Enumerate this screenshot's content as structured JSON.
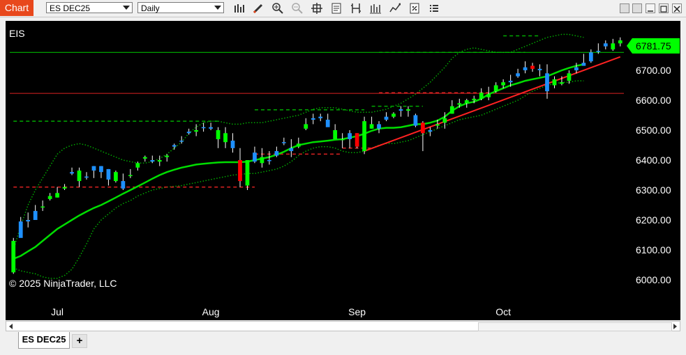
{
  "window": {
    "chart_label": "Chart",
    "instrument": "ES DEC25",
    "period": "Daily",
    "tab_label": "ES DEC25",
    "add_tab": "+",
    "toolbar_icons": [
      "bar-type-icon",
      "draw-tool-icon",
      "zoom-in-icon",
      "zoom-out-icon",
      "crosshair-icon",
      "data-box-icon",
      "indicators-icon",
      "strategies-icon",
      "chart-trader-icon",
      "properties-icon",
      "options-icon"
    ]
  },
  "chart_data": {
    "type": "candlestick",
    "instrument_label": "EIS",
    "copyright": "© 2025 NinjaTrader, LLC",
    "last_price": "6781.75",
    "y_tick_labels": [
      "6700.00",
      "6600.00",
      "6500.00",
      "6400.00",
      "6300.00",
      "6200.00",
      "6100.00",
      "6000.00"
    ],
    "y_ticks": [
      6700,
      6600,
      6500,
      6400,
      6300,
      6200,
      6100,
      6000
    ],
    "x_tick_labels": [
      "Jul",
      "Aug",
      "Sep",
      "Oct"
    ],
    "x_tick_bar_index": [
      6,
      27,
      47,
      67
    ],
    "colors": {
      "up": "#00ff00",
      "down": "#ff0000",
      "neutral": "#1e90ff",
      "ma": "#00dd00",
      "band": "#00aa00",
      "level_green": "#00cc00",
      "level_red": "#dd2222",
      "price_tag": "#00ff00"
    },
    "candles": [
      [
        6130,
        6140,
        6020,
        6025
      ],
      [
        6195,
        6210,
        6180,
        6140
      ],
      [
        6200,
        6225,
        6175,
        6195
      ],
      [
        6230,
        6250,
        6220,
        6200
      ],
      [
        6245,
        6265,
        6230,
        6245
      ],
      [
        6270,
        6290,
        6265,
        6280
      ],
      [
        6290,
        6310,
        6275,
        6275
      ],
      [
        6305,
        6320,
        6300,
        6310
      ],
      [
        6355,
        6375,
        6350,
        6360
      ],
      [
        6330,
        6375,
        6310,
        6365
      ],
      [
        6345,
        6360,
        6335,
        6345
      ],
      [
        6365,
        6380,
        6340,
        6380
      ],
      [
        6360,
        6380,
        6340,
        6380
      ],
      [
        6335,
        6370,
        6315,
        6370
      ],
      [
        6330,
        6365,
        6325,
        6360
      ],
      [
        6305,
        6355,
        6300,
        6330
      ],
      [
        6350,
        6370,
        6340,
        6350
      ],
      [
        6375,
        6395,
        6365,
        6390
      ],
      [
        6405,
        6415,
        6395,
        6410
      ],
      [
        6400,
        6415,
        6390,
        6395
      ],
      [
        6400,
        6415,
        6380,
        6395
      ],
      [
        6410,
        6420,
        6395,
        6415
      ],
      [
        6445,
        6455,
        6435,
        6450
      ],
      [
        6465,
        6480,
        6455,
        6465
      ],
      [
        6495,
        6505,
        6485,
        6490
      ],
      [
        6500,
        6520,
        6480,
        6495
      ],
      [
        6510,
        6525,
        6495,
        6510
      ],
      [
        6510,
        6525,
        6500,
        6505
      ],
      [
        6500,
        6510,
        6440,
        6470
      ],
      [
        6490,
        6510,
        6440,
        6460
      ],
      [
        6465,
        6490,
        6425,
        6440
      ],
      [
        6400,
        6440,
        6310,
        6330
      ],
      [
        6315,
        6400,
        6300,
        6400
      ],
      [
        6425,
        6445,
        6390,
        6395
      ],
      [
        6410,
        6440,
        6375,
        6390
      ],
      [
        6400,
        6430,
        6385,
        6400
      ],
      [
        6430,
        6445,
        6410,
        6415
      ],
      [
        6460,
        6475,
        6450,
        6460
      ],
      [
        6440,
        6470,
        6410,
        6430
      ],
      [
        6455,
        6475,
        6440,
        6445
      ],
      [
        6520,
        6540,
        6500,
        6505
      ],
      [
        6540,
        6555,
        6520,
        6535
      ],
      [
        6545,
        6555,
        6530,
        6540
      ],
      [
        6535,
        6555,
        6515,
        6510
      ],
      [
        6500,
        6520,
        6475,
        6470
      ],
      [
        6470,
        6490,
        6440,
        6470
      ],
      [
        6470,
        6500,
        6440,
        6490
      ],
      [
        6445,
        6490,
        6440,
        6490
      ],
      [
        6530,
        6545,
        6420,
        6430
      ],
      [
        6520,
        6545,
        6505,
        6505
      ],
      [
        6505,
        6530,
        6490,
        6520
      ],
      [
        6545,
        6560,
        6530,
        6535
      ],
      [
        6545,
        6560,
        6540,
        6555
      ],
      [
        6570,
        6580,
        6545,
        6565
      ],
      [
        6570,
        6580,
        6545,
        6565
      ],
      [
        6515,
        6555,
        6510,
        6550
      ],
      [
        6490,
        6530,
        6430,
        6525
      ],
      [
        6500,
        6510,
        6480,
        6495
      ],
      [
        6520,
        6535,
        6505,
        6515
      ],
      [
        6525,
        6560,
        6505,
        6540
      ],
      [
        6580,
        6600,
        6555,
        6555
      ],
      [
        6585,
        6605,
        6575,
        6590
      ],
      [
        6590,
        6605,
        6575,
        6600
      ],
      [
        6600,
        6615,
        6590,
        6605
      ],
      [
        6625,
        6640,
        6600,
        6605
      ],
      [
        6620,
        6645,
        6600,
        6610
      ],
      [
        6650,
        6660,
        6625,
        6630
      ],
      [
        6660,
        6670,
        6640,
        6650
      ],
      [
        6665,
        6685,
        6645,
        6660
      ],
      [
        6690,
        6705,
        6675,
        6680
      ],
      [
        6700,
        6730,
        6690,
        6710
      ],
      [
        6715,
        6725,
        6695,
        6705
      ],
      [
        6705,
        6720,
        6680,
        6700
      ],
      [
        6690,
        6720,
        6605,
        6630
      ],
      [
        6670,
        6680,
        6640,
        6650
      ],
      [
        6660,
        6680,
        6650,
        6655
      ],
      [
        6690,
        6700,
        6655,
        6665
      ],
      [
        6710,
        6725,
        6690,
        6700
      ],
      [
        6725,
        6755,
        6715,
        6715
      ],
      [
        6760,
        6770,
        6725,
        6730
      ],
      [
        6765,
        6790,
        6755,
        6765
      ],
      [
        6790,
        6800,
        6770,
        6780
      ],
      [
        6790,
        6805,
        6765,
        6770
      ],
      [
        6800,
        6810,
        6780,
        6790
      ]
    ],
    "bar_colors": "gbbbggggbgbbbbgbgggbggbbbgbbggbrgbgbbbbggbbbggbrggbbgbgbrbggggggggggbbbrbbgggbbbbb",
    "moving_average": {
      "from_index": 0,
      "values": [
        6070,
        6080,
        6095,
        6110,
        6130,
        6150,
        6170,
        6185,
        6200,
        6215,
        6228,
        6240,
        6250,
        6262,
        6275,
        6288,
        6300,
        6312,
        6325,
        6338,
        6350,
        6360,
        6368,
        6375,
        6380,
        6385,
        6388,
        6390,
        6392,
        6393,
        6393,
        6393,
        6395,
        6400,
        6405,
        6410,
        6418,
        6428,
        6440,
        6450,
        6455,
        6460,
        6462,
        6465,
        6468,
        6470,
        6475,
        6480,
        6488,
        6498,
        6505,
        6508,
        6508,
        6510,
        6515,
        6520,
        6520,
        6525,
        6532,
        6545,
        6565,
        6580,
        6590,
        6595,
        6605,
        6620,
        6630,
        6640,
        6650,
        6657,
        6665,
        6670,
        6675,
        6680,
        6690,
        6700,
        6708,
        6715,
        6720
      ]
    },
    "upper_band": {
      "from_index": 0,
      "values": [
        6100,
        6180,
        6250,
        6300,
        6340,
        6380,
        6420,
        6440,
        6450,
        6455,
        6450,
        6440,
        6430,
        6420,
        6410,
        6400,
        6395,
        6390,
        6390,
        6395,
        6405,
        6420,
        6440,
        6460,
        6490,
        6510,
        6525,
        6530,
        6530,
        6525,
        6520,
        6520,
        6525,
        6525,
        6525,
        6530,
        6535,
        6540,
        6545,
        6550,
        6560,
        6570,
        6575,
        6575,
        6575,
        6570,
        6565,
        6560,
        6560,
        6560,
        6565,
        6570,
        6580,
        6590,
        6605,
        6620,
        6640,
        6660,
        6685,
        6710,
        6740,
        6760,
        6770,
        6775,
        6770,
        6765,
        6760,
        6760,
        6760,
        6770,
        6780,
        6790,
        6800,
        6810,
        6815,
        6820,
        6820,
        6815,
        6810
      ]
    },
    "lower_band": {
      "from_index": 0,
      "values": [
        6040,
        6030,
        6025,
        6020,
        6010,
        6005,
        6005,
        6015,
        6035,
        6075,
        6120,
        6170,
        6200,
        6220,
        6240,
        6255,
        6265,
        6280,
        6290,
        6300,
        6305,
        6310,
        6312,
        6315,
        6320,
        6325,
        6330,
        6335,
        6340,
        6345,
        6350,
        6352,
        6355,
        6355,
        6360,
        6365,
        6370,
        6380,
        6395,
        6415,
        6430,
        6440,
        6445,
        6445,
        6440,
        6430,
        6425,
        6425,
        6430,
        6440,
        6450,
        6455,
        6455,
        6460,
        6465,
        6475,
        6485,
        6495,
        6505,
        6515,
        6525,
        6535,
        6540,
        6545,
        6550,
        6560,
        6570,
        6580,
        6590,
        6600,
        6615,
        6630,
        6640,
        6650,
        6655,
        6660,
        6660,
        6665,
        6665
      ]
    },
    "lines": [
      {
        "kind": "horizontal",
        "price": 6760,
        "style": "solid",
        "color": "#00cc00"
      },
      {
        "kind": "horizontal",
        "price": 6623,
        "style": "solid",
        "color": "#dd2222"
      },
      {
        "kind": "segment",
        "from": [
          48,
          6430
        ],
        "to": [
          83,
          6745
        ],
        "style": "solid",
        "color": "#ff2222"
      },
      {
        "kind": "segment",
        "from": [
          0,
          6530
        ],
        "to": [
          28,
          6530
        ],
        "style": "dashed",
        "color": "#00aa00"
      },
      {
        "kind": "segment",
        "from": [
          0,
          6310
        ],
        "to": [
          33,
          6310
        ],
        "style": "dashed",
        "color": "#dd2222"
      },
      {
        "kind": "segment",
        "from": [
          33,
          6568
        ],
        "to": [
          48,
          6568
        ],
        "style": "dashed",
        "color": "#00aa00"
      },
      {
        "kind": "segment",
        "from": [
          33,
          6420
        ],
        "to": [
          45,
          6420
        ],
        "style": "dashed",
        "color": "#dd2222"
      },
      {
        "kind": "segment",
        "from": [
          45,
          6440
        ],
        "to": [
          49,
          6440
        ],
        "style": "dashed",
        "color": "#dd2222"
      },
      {
        "kind": "segment",
        "from": [
          49,
          6580
        ],
        "to": [
          56,
          6580
        ],
        "style": "dashed",
        "color": "#00aa00"
      },
      {
        "kind": "segment",
        "from": [
          50,
          6625
        ],
        "to": [
          65,
          6625
        ],
        "style": "dashed",
        "color": "#dd2222"
      },
      {
        "kind": "segment",
        "from": [
          50,
          6760
        ],
        "to": [
          70,
          6760
        ],
        "style": "dashed",
        "color": "#00aa00"
      },
      {
        "kind": "segment",
        "from": [
          67,
          6815
        ],
        "to": [
          72,
          6815
        ],
        "style": "dashed",
        "color": "#00aa00"
      }
    ],
    "ylim": [
      5980,
      6840
    ]
  }
}
